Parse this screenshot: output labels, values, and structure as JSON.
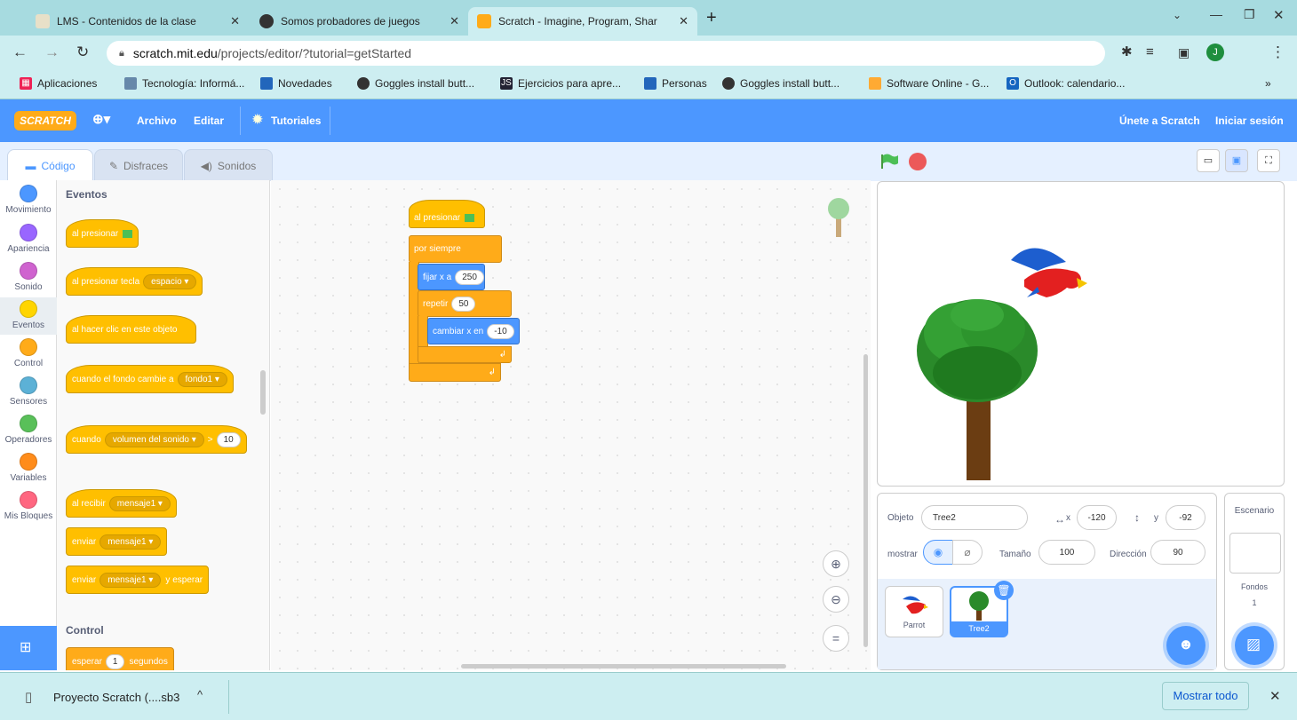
{
  "browser": {
    "tabs": [
      {
        "title": "LMS - Contenidos de la clase"
      },
      {
        "title": "Somos probadores de juegos"
      },
      {
        "title": "Scratch - Imagine, Program, Shar"
      }
    ],
    "url_host": "scratch.mit.edu",
    "url_path": "/projects/editor/?tutorial=getStarted",
    "profile_initial": "J",
    "bookmarks": [
      {
        "label": "Aplicaciones"
      },
      {
        "label": "Tecnología: Informá..."
      },
      {
        "label": "Novedades"
      },
      {
        "label": "Goggles install butt..."
      },
      {
        "label": "Ejercicios para apre..."
      },
      {
        "label": "Personas"
      },
      {
        "label": "Goggles install butt..."
      },
      {
        "label": "Software Online - G..."
      },
      {
        "label": "Outlook: calendario..."
      }
    ],
    "bookmarks_more": "»"
  },
  "menubar": {
    "logo": "SCRATCH",
    "archivo": "Archivo",
    "editar": "Editar",
    "tutoriales": "Tutoriales",
    "join": "Únete a Scratch",
    "signin": "Iniciar sesión"
  },
  "editor_tabs": {
    "code": "Código",
    "costumes": "Disfraces",
    "sounds": "Sonidos"
  },
  "categories": [
    {
      "label": "Movimiento",
      "color": "#4c97ff"
    },
    {
      "label": "Apariencia",
      "color": "#9966ff"
    },
    {
      "label": "Sonido",
      "color": "#cf63cf"
    },
    {
      "label": "Eventos",
      "color": "#ffd500"
    },
    {
      "label": "Control",
      "color": "#ffab19"
    },
    {
      "label": "Sensores",
      "color": "#5cb1d6"
    },
    {
      "label": "Operadores",
      "color": "#59c059"
    },
    {
      "label": "Variables",
      "color": "#ff8c1a"
    },
    {
      "label": "Mis Bloques",
      "color": "#ff6680"
    }
  ],
  "palette": {
    "events_heading": "Eventos",
    "b1": "al presionar",
    "b2": "al presionar tecla",
    "b2_dd": "espacio ▾",
    "b3": "al hacer clic en este objeto",
    "b4": "cuando el fondo cambie a",
    "b4_dd": "fondo1 ▾",
    "b5": "cuando",
    "b5_dd": "volumen del sonido ▾",
    "b5_op": ">",
    "b5_val": "10",
    "b6": "al recibir",
    "b6_dd": "mensaje1 ▾",
    "b7": "enviar",
    "b7_dd": "mensaje1 ▾",
    "b8": "enviar",
    "b8_dd": "mensaje1 ▾",
    "b8_tail": "y esperar",
    "control_heading": "Control",
    "b9": "esperar",
    "b9_val": "1",
    "b9_tail": "segundos"
  },
  "script": {
    "hat": "al presionar",
    "forever": "por siempre",
    "setx": "fijar x a",
    "setx_val": "250",
    "repeat": "repetir",
    "repeat_val": "50",
    "changex": "cambiar x en",
    "changex_val": "-10"
  },
  "sprite_info": {
    "objeto_label": "Objeto",
    "name": "Tree2",
    "x_label": "x",
    "x": "-120",
    "y_label": "y",
    "y": "-92",
    "show_label": "mostrar",
    "size_label": "Tamaño",
    "size": "100",
    "direction_label": "Dirección",
    "direction": "90"
  },
  "sprites": [
    {
      "name": "Parrot"
    },
    {
      "name": "Tree2"
    }
  ],
  "scene": {
    "title": "Escenario",
    "backdrops_label": "Fondos",
    "backdrops_count": "1"
  },
  "download": {
    "file": "Proyecto Scratch (....sb3",
    "show_all": "Mostrar todo"
  }
}
